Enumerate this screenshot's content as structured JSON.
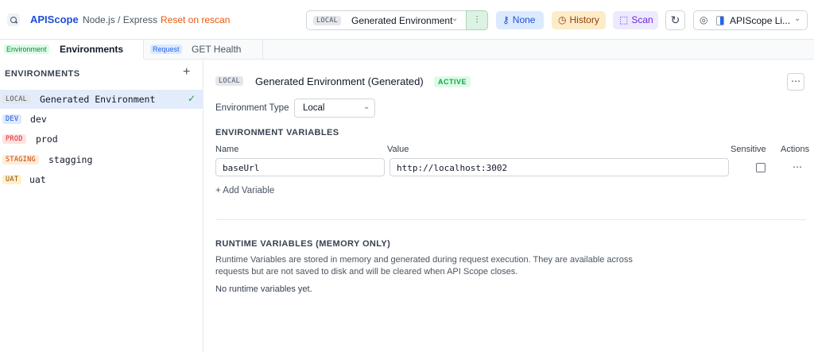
{
  "header": {
    "app_name": "APIScope",
    "framework": "Node.js / Express",
    "reset_link": "Reset on rescan",
    "env_selector": {
      "badge": "LOCAL",
      "label": "Generated Environment"
    },
    "auth_button": "None",
    "history_button": "History",
    "scan_button": "Scan",
    "profile_selector": "APIScope Li..."
  },
  "tabs": [
    {
      "tag": "Environment",
      "label": "Environments"
    },
    {
      "tag": "Request",
      "label": "GET Health"
    }
  ],
  "sidebar": {
    "title": "ENVIRONMENTS",
    "items": [
      {
        "badge": "LOCAL",
        "name": "Generated Environment",
        "active": true
      },
      {
        "badge": "DEV",
        "name": "dev"
      },
      {
        "badge": "PROD",
        "name": "prod"
      },
      {
        "badge": "STAGING",
        "name": "stagging"
      },
      {
        "badge": "UAT",
        "name": "uat"
      }
    ]
  },
  "main": {
    "badge": "LOCAL",
    "title": "Generated Environment (Generated)",
    "status": "ACTIVE",
    "env_type_label": "Environment Type",
    "env_type_value": "Local",
    "variables_title": "ENVIRONMENT VARIABLES",
    "columns": {
      "name": "Name",
      "value": "Value",
      "sensitive": "Sensitive",
      "actions": "Actions"
    },
    "variables": [
      {
        "name": "baseUrl",
        "value": "http://localhost:3002",
        "sensitive": false
      }
    ],
    "add_variable": "+ Add Variable",
    "runtime_title": "RUNTIME VARIABLES (MEMORY ONLY)",
    "runtime_desc": "Runtime Variables are stored in memory and generated during request execution. They are available across requests but are not saved to disk and will be cleared when API Scope closes.",
    "runtime_empty": "No runtime variables yet."
  }
}
